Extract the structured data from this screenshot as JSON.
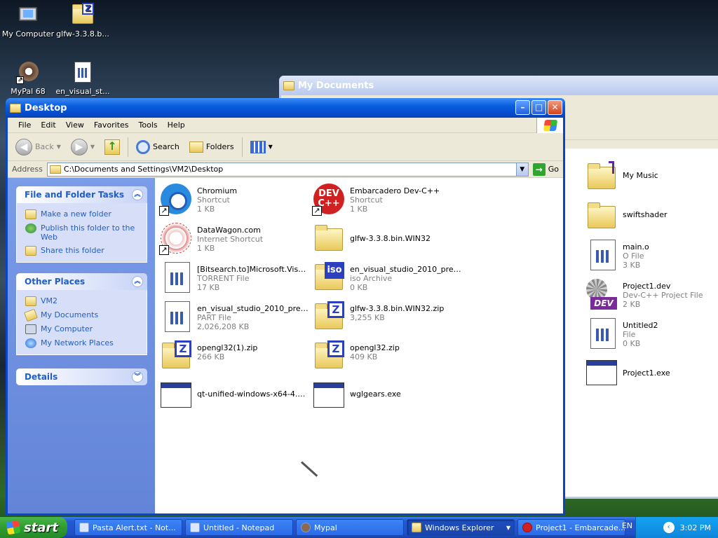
{
  "desktop": {
    "icons": [
      {
        "label": "My Computer",
        "icon": "my-computer-icon"
      },
      {
        "label": "glfw-3.3.8.b...",
        "icon": "zip-folder-icon"
      },
      {
        "label": "MyPal 68",
        "icon": "mypal-browser-icon"
      },
      {
        "label": "en_visual_st...",
        "icon": "document-icon"
      }
    ]
  },
  "back_window": {
    "title": "My Documents",
    "items": [
      {
        "name": "My Music",
        "sub1": "",
        "sub2": "",
        "icon": "music-folder-icon"
      },
      {
        "name": "swiftshader",
        "sub1": "",
        "sub2": "",
        "icon": "folder-icon"
      },
      {
        "name": "main.o",
        "sub1": "O File",
        "sub2": "3 KB",
        "icon": "file-icon"
      },
      {
        "name": "Project1.dev",
        "sub1": "Dev-C++ Project File",
        "sub2": "2 KB",
        "icon": "dev-project-icon"
      },
      {
        "name": "Untitled2",
        "sub1": "File",
        "sub2": "0 KB",
        "icon": "file-icon"
      },
      {
        "name": "Project1.exe",
        "sub1": "",
        "sub2": "",
        "icon": "exe-icon"
      }
    ]
  },
  "window": {
    "title": "Desktop",
    "menu": [
      "File",
      "Edit",
      "View",
      "Favorites",
      "Tools",
      "Help"
    ],
    "toolbar": {
      "back": "Back",
      "search": "Search",
      "folders": "Folders"
    },
    "address": {
      "label": "Address",
      "value": "C:\\Documents and Settings\\VM2\\Desktop",
      "go": "Go"
    },
    "tasks_panel": {
      "title": "File and Folder Tasks",
      "items": [
        "Make a new folder",
        "Publish this folder to the Web",
        "Share this folder"
      ]
    },
    "places_panel": {
      "title": "Other Places",
      "items": [
        "VM2",
        "My Documents",
        "My Computer",
        "My Network Places"
      ]
    },
    "details_panel": {
      "title": "Details"
    },
    "files": [
      {
        "name": "Chromium",
        "type": "Shortcut",
        "size": "1 KB",
        "icon": "chromium-icon"
      },
      {
        "name": "Embarcadero Dev-C++",
        "type": "Shortcut",
        "size": "1 KB",
        "icon": "devcpp-icon"
      },
      {
        "name": "DataWagon.com",
        "type": "Internet Shortcut",
        "size": "1 KB",
        "icon": "internet-shortcut-icon"
      },
      {
        "name": "glfw-3.3.8.bin.WIN32",
        "type": "",
        "size": "",
        "icon": "folder-icon"
      },
      {
        "name": "[Bitsearch.to]Microsoft.Visual....",
        "type": "TORRENT File",
        "size": "17 KB",
        "icon": "document-icon"
      },
      {
        "name": "en_visual_studio_2010_premi...",
        "type": "iso Archive",
        "size": "0 KB",
        "icon": "iso-icon"
      },
      {
        "name": "en_visual_studio_2010_premi...",
        "type": "PART File",
        "size": "2,026,208 KB",
        "icon": "document-icon"
      },
      {
        "name": "glfw-3.3.8.bin.WIN32.zip",
        "type": "",
        "size": "3,255 KB",
        "icon": "zip-folder-icon"
      },
      {
        "name": "opengl32(1).zip",
        "type": "",
        "size": "266 KB",
        "icon": "zip-folder-icon"
      },
      {
        "name": "opengl32.zip",
        "type": "",
        "size": "409 KB",
        "icon": "zip-folder-icon"
      },
      {
        "name": "qt-unified-windows-x64-4.5.1...",
        "type": "",
        "size": "",
        "icon": "exe-icon"
      },
      {
        "name": "wglgears.exe",
        "type": "",
        "size": "",
        "icon": "exe-icon"
      }
    ]
  },
  "taskbar": {
    "start": "start",
    "tasks": [
      {
        "label": "Pasta Alert.txt - Not...",
        "active": false
      },
      {
        "label": "Untitled - Notepad",
        "active": false
      },
      {
        "label": "Mypal",
        "active": false
      },
      {
        "label": "Windows Explorer",
        "active": true
      },
      {
        "label": "Project1 - Embarcade...",
        "active": false
      }
    ],
    "language": "EN",
    "clock": "3:02 PM"
  },
  "colors": {
    "title_blue": "#0a5ee0",
    "taskbar_blue": "#2459d2",
    "start_green": "#2e9b30",
    "link_blue": "#215dc6"
  }
}
